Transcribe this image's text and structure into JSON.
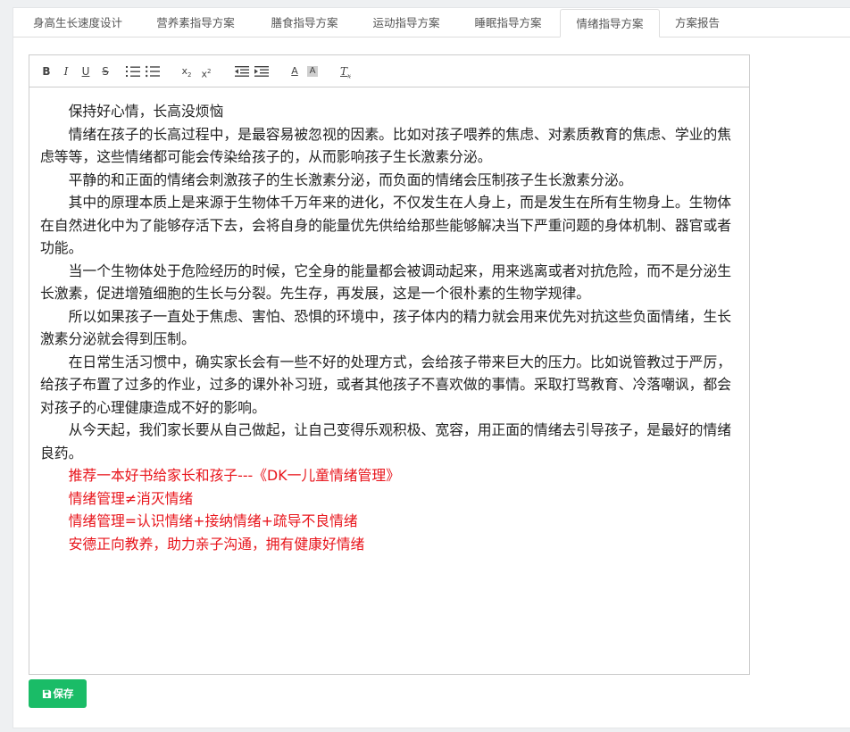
{
  "tabs": [
    {
      "label": "身高生长速度设计",
      "active": false
    },
    {
      "label": "营养素指导方案",
      "active": false
    },
    {
      "label": "膳食指导方案",
      "active": false
    },
    {
      "label": "运动指导方案",
      "active": false
    },
    {
      "label": "睡眠指导方案",
      "active": false
    },
    {
      "label": "情绪指导方案",
      "active": true
    },
    {
      "label": "方案报告",
      "active": false
    }
  ],
  "toolbar": {
    "bold": "B",
    "italic": "I",
    "underline": "U",
    "strike": "S",
    "subscript": "x",
    "subscript_mark": "2",
    "superscript": "x",
    "superscript_mark": "2",
    "font_color": "A",
    "bg_color": "A",
    "clear_format": "T",
    "clear_format_mark": "x"
  },
  "editor": {
    "paragraphs": [
      {
        "text": "保持好心情，长高没烦恼",
        "color": "#222222"
      },
      {
        "text": "情绪在孩子的长高过程中，是最容易被忽视的因素。比如对孩子喂养的焦虑、对素质教育的焦虑、学业的焦虑等等，这些情绪都可能会传染给孩子的，从而影响孩子生长激素分泌。",
        "color": "#222222"
      },
      {
        "text": "平静的和正面的情绪会刺激孩子的生长激素分泌，而负面的情绪会压制孩子生长激素分泌。",
        "color": "#222222"
      },
      {
        "text": "其中的原理本质上是来源于生物体千万年来的进化，不仅发生在人身上，而是发生在所有生物身上。生物体在自然进化中为了能够存活下去，会将自身的能量优先供给给那些能够解决当下严重问题的身体机制、器官或者功能。",
        "color": "#222222"
      },
      {
        "text": "当一个生物体处于危险经历的时候，它全身的能量都会被调动起来，用来逃离或者对抗危险，而不是分泌生长激素，促进增殖细胞的生长与分裂。先生存，再发展，这是一个很朴素的生物学规律。",
        "color": "#222222"
      },
      {
        "text": "所以如果孩子一直处于焦虑、害怕、恐惧的环境中，孩子体内的精力就会用来优先对抗这些负面情绪，生长激素分泌就会得到压制。",
        "color": "#222222"
      },
      {
        "text": "在日常生活习惯中，确实家长会有一些不好的处理方式，会给孩子带来巨大的压力。比如说管教过于严厉，给孩子布置了过多的作业，过多的课外补习班，或者其他孩子不喜欢做的事情。采取打骂教育、冷落嘲讽，都会对孩子的心理健康造成不好的影响。",
        "color": "#222222"
      },
      {
        "text": "从今天起，我们家长要从自己做起，让自己变得乐观积极、宽容，用正面的情绪去引导孩子，是最好的情绪良药。",
        "color": "#222222"
      },
      {
        "text": "推荐一本好书给家长和孩子---《DK一儿童情绪管理》",
        "color": "#e8141b"
      },
      {
        "text": "情绪管理≠消灭情绪",
        "color": "#e8141b"
      },
      {
        "text": "情绪管理=认识情绪+接纳情绪+疏导不良情绪",
        "color": "#e8141b"
      },
      {
        "text": "安德正向教养，助力亲子沟通，拥有健康好情绪",
        "color": "#e8141b"
      }
    ]
  },
  "save_button": {
    "label": "保存",
    "icon": "save-icon",
    "color": "#1abc67"
  },
  "colors": {
    "text": "#222222",
    "highlight_red": "#e8141b",
    "accent_green": "#1abc67"
  }
}
